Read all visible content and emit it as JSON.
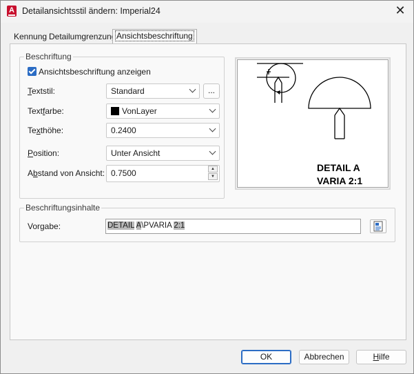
{
  "window": {
    "title": "Detailansichtsstil ändern: Imperial24",
    "app_icon_letter": "A",
    "close_glyph": "✕"
  },
  "tabs": [
    {
      "label": "Kennung"
    },
    {
      "label": "Detailumgrenzung"
    },
    {
      "label": "Ansichtsbeschriftung"
    }
  ],
  "beschriftung": {
    "group_label": "Beschriftung",
    "show_label_checkbox": "Ansichtsbeschriftung anzeigen",
    "show_label_checked": true,
    "textstil": {
      "label_u": "T",
      "label_rest": "extstil:",
      "value": "Standard",
      "browse_label": "..."
    },
    "textfarbe": {
      "label_pre": "Text",
      "label_u": "f",
      "label_rest": "arbe:",
      "value": "VonLayer",
      "swatch_color": "#000000"
    },
    "texthoehe": {
      "label_pre": "Te",
      "label_u": "x",
      "label_rest": "thöhe:",
      "value": "0.2400"
    },
    "position": {
      "label_u": "P",
      "label_rest": "osition:",
      "value": "Unter Ansicht"
    },
    "abstand": {
      "label_pre": "A",
      "label_u": "b",
      "label_rest": "stand von Ansicht:",
      "value": "0.7500"
    }
  },
  "preview": {
    "line1": "DETAIL A",
    "line2": "VARIA 2:1"
  },
  "inhalte": {
    "group_label": "Beschriftungsinhalte",
    "vorgabe_label": "Vorgabe:",
    "vorgabe_value_parts": [
      "DETAIL",
      " ",
      "A",
      "\\PVARIA ",
      "2:1"
    ]
  },
  "buttons": {
    "ok": "OK",
    "cancel": "Abbrechen",
    "help_u": "H",
    "help_rest": "ilfe"
  },
  "colors": {
    "accent": "#2b6cc4",
    "app_icon": "#c8102e"
  }
}
